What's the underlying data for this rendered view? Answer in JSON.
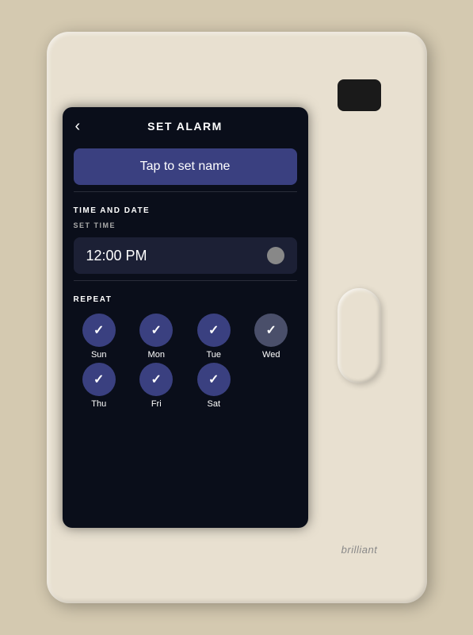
{
  "screen": {
    "header": {
      "title": "SET ALARM",
      "back_label": "‹"
    },
    "name_button": {
      "label": "Tap to set name"
    },
    "sections": {
      "time_and_date_label": "TIME AND DATE",
      "set_time_label": "SET TIME",
      "time_value": "12:00 PM",
      "repeat_label": "REPEAT"
    },
    "days": [
      {
        "label": "Sun",
        "selected": true,
        "row": 1
      },
      {
        "label": "Mon",
        "selected": true,
        "row": 1
      },
      {
        "label": "Tue",
        "selected": true,
        "row": 1
      },
      {
        "label": "Wed",
        "selected": true,
        "row": 1
      },
      {
        "label": "Thu",
        "selected": true,
        "row": 2
      },
      {
        "label": "Fri",
        "selected": true,
        "row": 2
      },
      {
        "label": "Sat",
        "selected": true,
        "row": 2
      }
    ]
  },
  "plate": {
    "brand_label": "brilliant"
  },
  "icons": {
    "back": "‹",
    "check": "✓"
  }
}
